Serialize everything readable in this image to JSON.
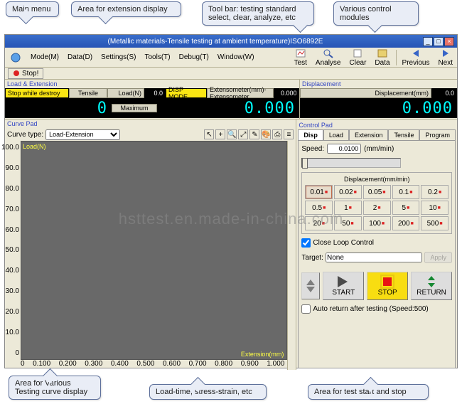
{
  "callouts": {
    "main_menu": "Main menu",
    "ext_area": "Area for extension display",
    "toolbar": "Tool bar: testing standard select, clear, analyze, etc",
    "modules": "Various control modules",
    "curve_area": "Area for Various Testing curve display",
    "load_time": "Load-time, stress-strain, etc",
    "start_stop": "Area for test start and stop"
  },
  "title": "(Metallic materials-Tensile testing at ambient temperature)ISO6892E",
  "menu": {
    "mode": "Mode(M)",
    "data": "Data(D)",
    "settings": "Settings(S)",
    "tools": "Tools(T)",
    "debug": "Debug(T)",
    "window": "Window(W)",
    "test": "Test",
    "analyse": "Analyse",
    "clear": "Clear",
    "data2": "Data",
    "prev": "Previous",
    "next": "Next"
  },
  "stop": "Stop!",
  "load_panel": {
    "title": "Load & Extension",
    "stop_while": "Stop while destroy",
    "tensile": "Tensile",
    "load_l": "Load(N)",
    "load_v": "0.0",
    "disp_mode": "DISP MODE",
    "ext_l": "Extensometer(mm)-Extensometer",
    "ext_v": "0.000",
    "zero": "0",
    "max": "Maximum",
    "led_ext": "0.000"
  },
  "disp_panel": {
    "title": "Displacement",
    "disp_l": "Displacement(mm)",
    "disp_v": "0.0",
    "led": "0.000"
  },
  "curve": {
    "title": "Curve Pad",
    "type_l": "Curve type:",
    "type_v": "Load-Extension",
    "ylabel": "Load(N)",
    "xlabel": "Extension(mm)",
    "yticks": [
      "100.0",
      "90.0",
      "80.0",
      "70.0",
      "60.0",
      "50.0",
      "40.0",
      "30.0",
      "20.0",
      "10.0",
      "0"
    ],
    "xticks": [
      "0",
      "0.100",
      "0.200",
      "0.300",
      "0.400",
      "0.500",
      "0.600",
      "0.700",
      "0.800",
      "0.900",
      "1.000"
    ]
  },
  "ctrl": {
    "title": "Control Pad",
    "tabs": {
      "disp": "Disp",
      "load": "Load",
      "ext": "Extension",
      "tensile": "Tensile",
      "prog": "Program"
    },
    "speed_l": "Speed:",
    "speed_v": "0.0100",
    "speed_u": "(mm/min)",
    "grid_l": "Displacement(mm/min)",
    "grid": [
      "0.01",
      "0.02",
      "0.05",
      "0.1",
      "0.2",
      "0.5",
      "1",
      "2",
      "5",
      "10",
      "20",
      "50",
      "100",
      "200",
      "500"
    ],
    "clc": "Close Loop Control",
    "target_l": "Target:",
    "target_v": "None",
    "apply": "Apply",
    "start": "START",
    "stop": "STOP",
    "return": "RETURN",
    "auto": "Auto return after testing (Speed:500)"
  },
  "watermark": "hsttest.en.made-in-china.com",
  "chart_data": {
    "type": "line",
    "title": "Load-Extension",
    "xlabel": "Extension(mm)",
    "ylabel": "Load(N)",
    "xlim": [
      0,
      1.0
    ],
    "ylim": [
      0,
      100
    ],
    "series": [
      {
        "name": "Load",
        "x": [],
        "y": []
      }
    ]
  }
}
